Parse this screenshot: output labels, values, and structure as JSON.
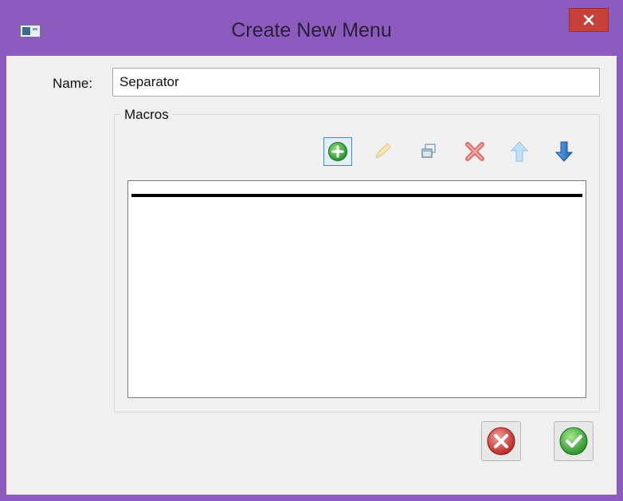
{
  "window": {
    "title": "Create New Menu",
    "accent_color": "#8b5bbd",
    "close_color": "#c8403a"
  },
  "form": {
    "name_label": "Name:",
    "name_value": "Separator"
  },
  "macros": {
    "group_title": "Macros",
    "toolbar": [
      {
        "name": "add-macro-button",
        "icon": "add-icon"
      },
      {
        "name": "edit-macro-button",
        "icon": "pencil-icon"
      },
      {
        "name": "copy-macro-button",
        "icon": "copy-icon"
      },
      {
        "name": "delete-macro-button",
        "icon": "delete-icon"
      },
      {
        "name": "move-up-button",
        "icon": "arrow-up-icon"
      },
      {
        "name": "move-down-button",
        "icon": "arrow-down-icon"
      }
    ],
    "items": [
      {
        "type": "separator"
      }
    ]
  },
  "actions": {
    "cancel_icon": "cancel-icon",
    "ok_icon": "ok-icon"
  }
}
